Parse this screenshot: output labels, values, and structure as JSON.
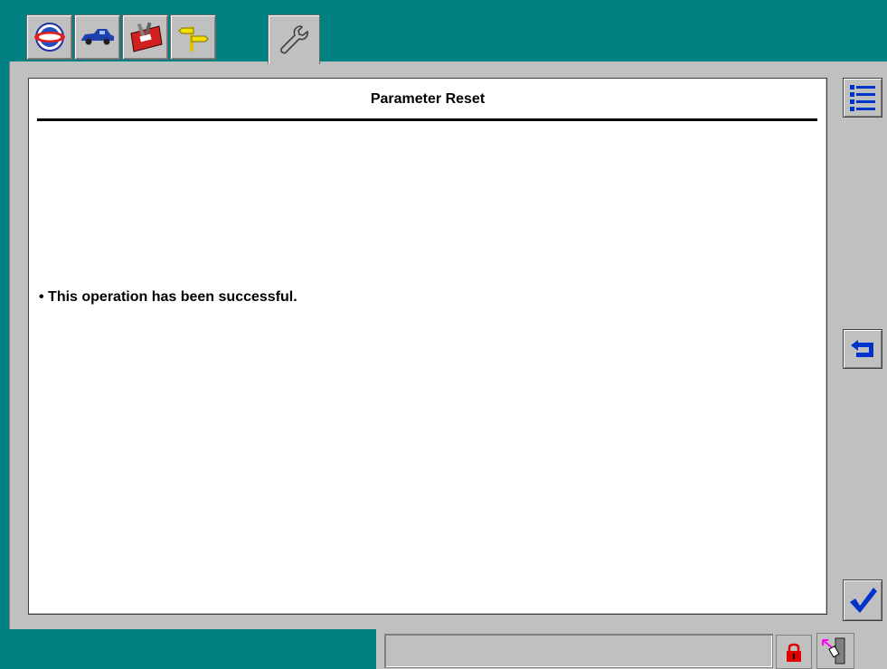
{
  "window": {
    "tabs": [
      {
        "icon": "obd-logo-icon"
      },
      {
        "icon": "vehicle-icon"
      },
      {
        "icon": "toolbox-icon"
      },
      {
        "icon": "signpost-icon"
      },
      {
        "icon": "wrench-icon",
        "active": true
      }
    ]
  },
  "screen": {
    "title": "Parameter Reset",
    "message": "• This operation has been successful."
  },
  "sidebar": {
    "buttons": [
      {
        "icon": "list-icon"
      },
      {
        "icon": "back-arrow-icon"
      },
      {
        "icon": "checkmark-icon"
      }
    ]
  },
  "statusbar": {
    "text": "",
    "icons": [
      "lock-icon",
      "tool-connect-icon"
    ]
  },
  "colors": {
    "background": "#008080",
    "panel": "#c0c0c0",
    "accent_blue": "#0033cc",
    "lock_red": "#e00000"
  }
}
